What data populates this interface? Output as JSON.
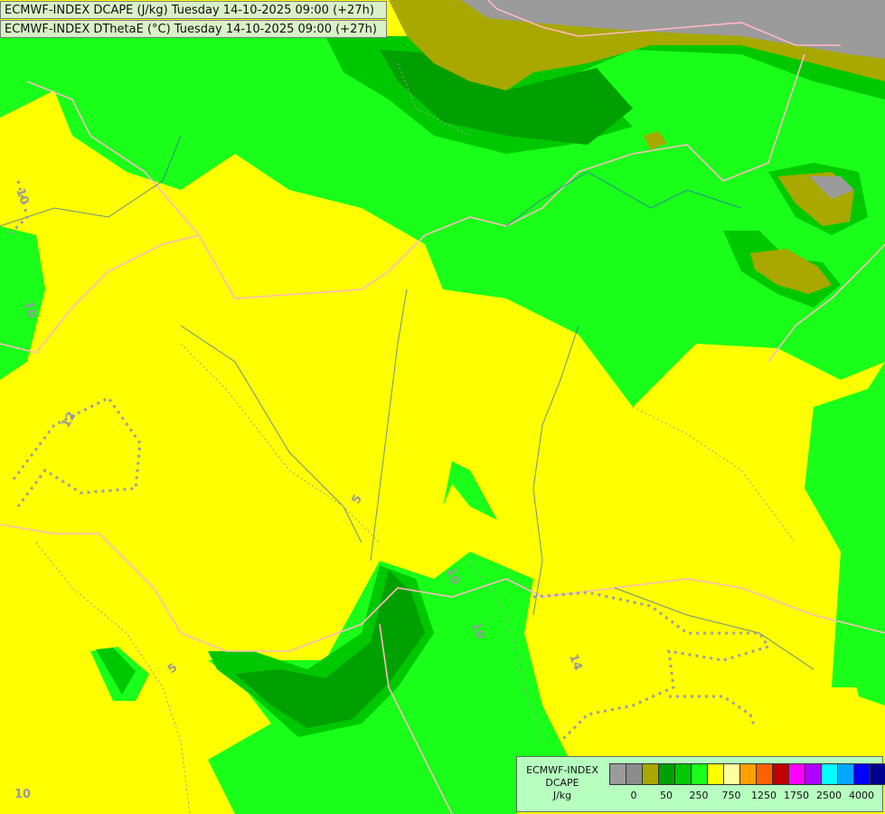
{
  "titles": {
    "line1": "ECMWF-INDEX DCAPE (J/kg) Tuesday 14-10-2025 09:00 (+27h)",
    "line2": "ECMWF-INDEX DThetaE (°C) Tuesday 14-10-2025 09:00 (+27h)"
  },
  "legend": {
    "model": "ECMWF-INDEX",
    "parameter": "DCAPE",
    "unit": "J/kg",
    "colors": [
      "#9b9b9b",
      "#8c8c8c",
      "#a8a800",
      "#00a000",
      "#00c800",
      "#19ff19",
      "#ffff00",
      "#ffffa0",
      "#ffa000",
      "#ff6000",
      "#c00000",
      "#ff00ff",
      "#b000ff",
      "#00ffff",
      "#00a8ff",
      "#0000ff",
      "#000090"
    ],
    "tick_labels": [
      "0",
      "50",
      "250",
      "750",
      "1250",
      "1750",
      "2500",
      "4000"
    ]
  },
  "contour_labels": [
    "10",
    "12",
    "10",
    "5",
    "5",
    "10",
    "10",
    "14",
    "10"
  ],
  "field_colors": {
    "yellow": "#ffff00",
    "light_green": "#19ff19",
    "green": "#00c800",
    "dark_green": "#00a000",
    "olive": "#a8a800",
    "gray": "#9b9b9b"
  }
}
